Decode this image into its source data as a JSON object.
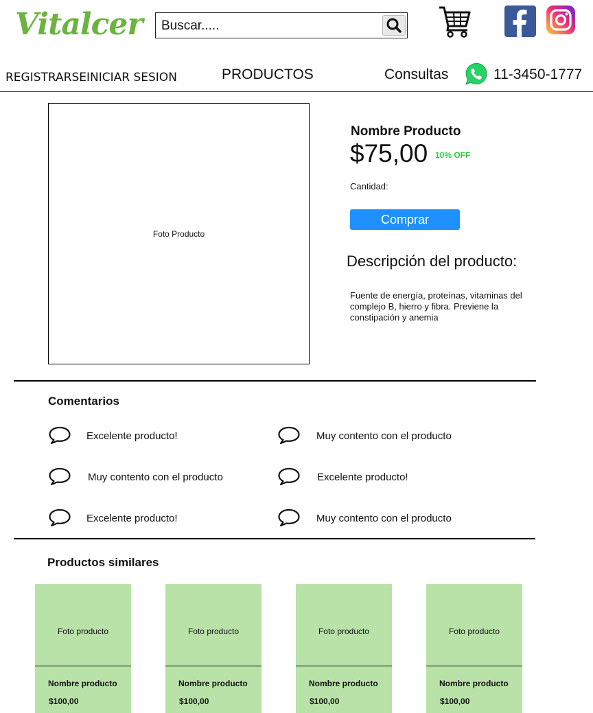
{
  "header": {
    "logo": "Vitalcer",
    "search_placeholder": "Buscar.....",
    "icons": [
      "search-icon",
      "cart-icon",
      "facebook-icon",
      "instagram-icon",
      "whatsapp-icon"
    ]
  },
  "nav": {
    "register": "REGISTRARSE",
    "login": "INICIAR SESION",
    "products": "PRODUCTOS",
    "contact": "Consultas",
    "phone": "11-3450-1777"
  },
  "product": {
    "photo_label": "Foto Producto",
    "name": "Nombre Producto",
    "price": "$75,00",
    "discount": "10% OFF",
    "quantity_label": "Cantidad:",
    "buy_label": "Comprar",
    "description_title": "Descripción del producto:",
    "description": "Fuente de energía, proteínas, vitaminas del complejo B, hierro y fibra. Previene la constipación y anemia"
  },
  "comments": {
    "title": "Comentarios",
    "items": [
      "Excelente producto!",
      "Muy contento con el producto",
      "Muy contento con el producto",
      "Excelente producto!",
      "Excelente producto!",
      "Muy contento con el producto"
    ]
  },
  "similar": {
    "title": "Productos similares",
    "items": [
      {
        "photo": "Foto producto",
        "name": "Nombre producto",
        "price": "$100,00"
      },
      {
        "photo": "Foto producto",
        "name": "Nombre producto",
        "price": "$100,00"
      },
      {
        "photo": "Foto producto",
        "name": "Nombre producto",
        "price": "$100,00"
      },
      {
        "photo": "Foto producto",
        "name": "Nombre producto",
        "price": "$100,00"
      }
    ]
  },
  "colors": {
    "brand_green": "#6cb33f",
    "buy_button": "#1e90ff",
    "discount": "#2ecc40",
    "card_bg": "#b9e2a8",
    "facebook": "#3b5998",
    "whatsapp": "#25d366"
  }
}
